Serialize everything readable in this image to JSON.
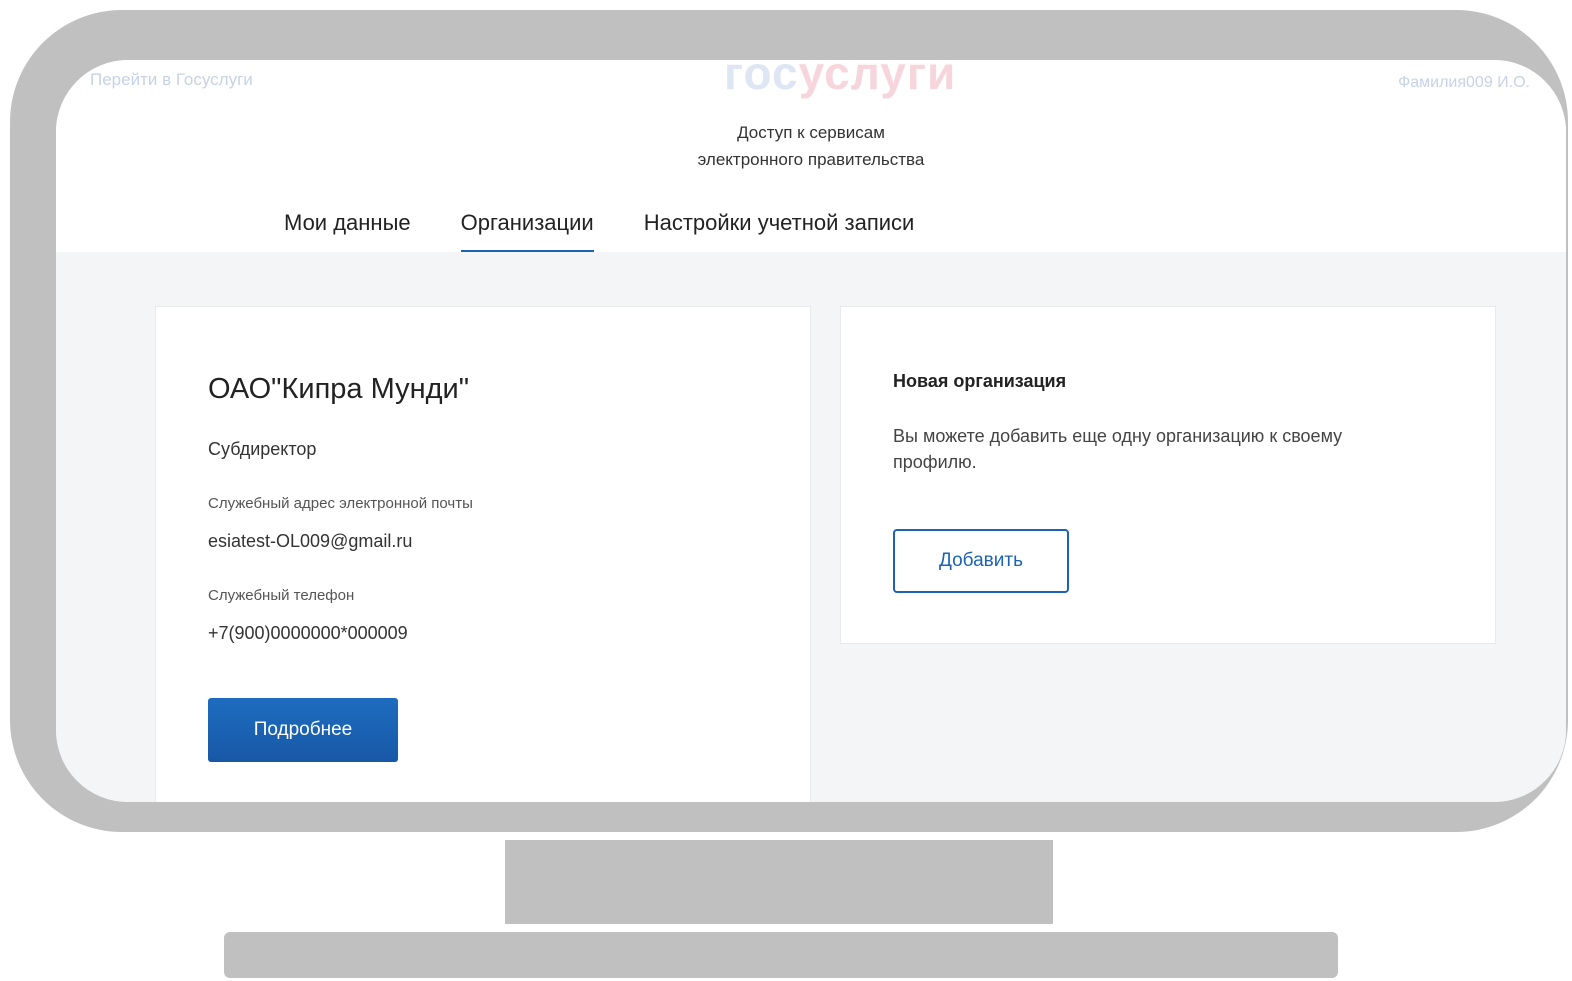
{
  "header": {
    "back_link": "Перейти в Госуслуги",
    "logo_part1": "гос",
    "logo_part2": "услуги",
    "user_name": "Фамилия009 И.О.",
    "subtitle_line1": "Доступ к сервисам",
    "subtitle_line2": "электронного правительства"
  },
  "tabs": [
    {
      "label": "Мои данные",
      "active": false
    },
    {
      "label": "Организации",
      "active": true
    },
    {
      "label": "Настройки учетной записи",
      "active": false
    }
  ],
  "organization_card": {
    "name": "ОАО\"Кипра Мунди\"",
    "role": "Субдиректор",
    "email_label": "Служебный адрес электронной почты",
    "email_value": "esiatest-OL009@gmail.ru",
    "phone_label": "Служебный телефон",
    "phone_value": "+7(900)0000000*000009",
    "details_button": "Подробнее"
  },
  "new_org_card": {
    "title": "Новая организация",
    "text": "Вы можете добавить еще одну организацию к своему профилю.",
    "add_button": "Добавить"
  },
  "colors": {
    "accent": "#1c64b3",
    "frame": "#c0c0c0",
    "content_bg": "#f3f5f7"
  }
}
